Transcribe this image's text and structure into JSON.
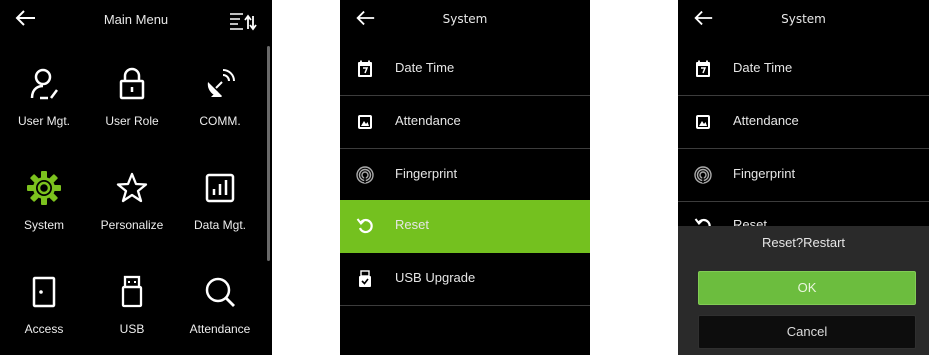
{
  "main_menu": {
    "title": "Main Menu",
    "items": [
      {
        "label": "User Mgt.",
        "icon": "user-icon"
      },
      {
        "label": "User Role",
        "icon": "lock-icon"
      },
      {
        "label": "COMM.",
        "icon": "satellite-dish-icon"
      },
      {
        "label": "System",
        "icon": "gear-icon"
      },
      {
        "label": "Personalize",
        "icon": "star-icon"
      },
      {
        "label": "Data Mgt.",
        "icon": "bar-chart-icon"
      },
      {
        "label": "Access",
        "icon": "door-icon"
      },
      {
        "label": "USB",
        "icon": "usb-icon"
      },
      {
        "label": "Attendance",
        "icon": "search-icon"
      }
    ],
    "highlight_color": "#7cc21e"
  },
  "system_menu": {
    "title": "System",
    "items": [
      {
        "label": "Date Time",
        "icon": "calendar-icon"
      },
      {
        "label": "Attendance",
        "icon": "attendance-icon"
      },
      {
        "label": "Fingerprint",
        "icon": "fingerprint-icon"
      },
      {
        "label": "Reset",
        "icon": "reset-icon"
      },
      {
        "label": "USB Upgrade",
        "icon": "usb-upgrade-icon"
      }
    ],
    "selected": "Reset",
    "selected_color": "#74c11f"
  },
  "reset_dialog": {
    "title": "System",
    "items": [
      {
        "label": "Date Time",
        "icon": "calendar-icon"
      },
      {
        "label": "Attendance",
        "icon": "attendance-icon"
      },
      {
        "label": "Fingerprint",
        "icon": "fingerprint-icon"
      },
      {
        "label": "Reset",
        "icon": "reset-icon"
      }
    ],
    "prompt": "Reset?Restart",
    "ok_label": "OK",
    "cancel_label": "Cancel",
    "ok_color": "#6cbd3e"
  }
}
